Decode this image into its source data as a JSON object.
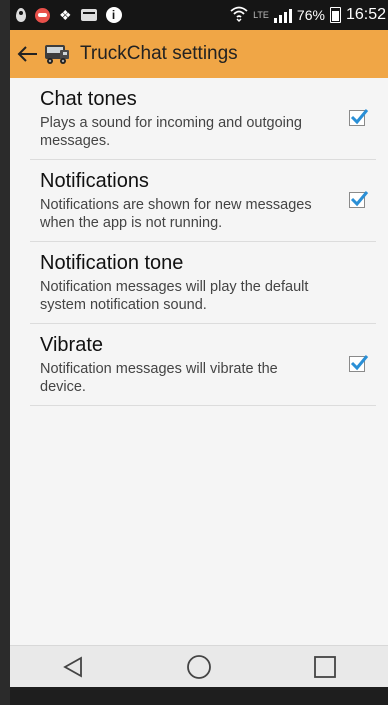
{
  "status_bar": {
    "battery_percent": "76%",
    "time": "16:52",
    "network_label": "LTE",
    "icons": [
      "location-icon",
      "notification-app-icon",
      "dropbox-icon",
      "message-icon",
      "info-icon",
      "wifi-icon",
      "signal-icon",
      "battery-icon"
    ]
  },
  "action_bar": {
    "title": "TruckChat settings",
    "back_icon": "back-arrow-icon",
    "app_icon": "truck-app-icon",
    "color": "#f0a646"
  },
  "settings": {
    "items": [
      {
        "title": "Chat tones",
        "summary": "Plays a sound for incoming and outgoing messages.",
        "checked": true
      },
      {
        "title": "Notifications",
        "summary": "Notifications are shown for new messages when the app is not running.",
        "checked": true
      },
      {
        "title": "Notification tone",
        "summary": "Notification messages will play the default system notification sound.",
        "checked": false
      },
      {
        "title": "Vibrate",
        "summary": "Notification messages will vibrate the device.",
        "checked": true
      }
    ],
    "check_color": "#2a8fd6"
  },
  "nav_bar": {
    "buttons": [
      "back-triangle-icon",
      "home-circle-icon",
      "recents-square-icon"
    ]
  }
}
